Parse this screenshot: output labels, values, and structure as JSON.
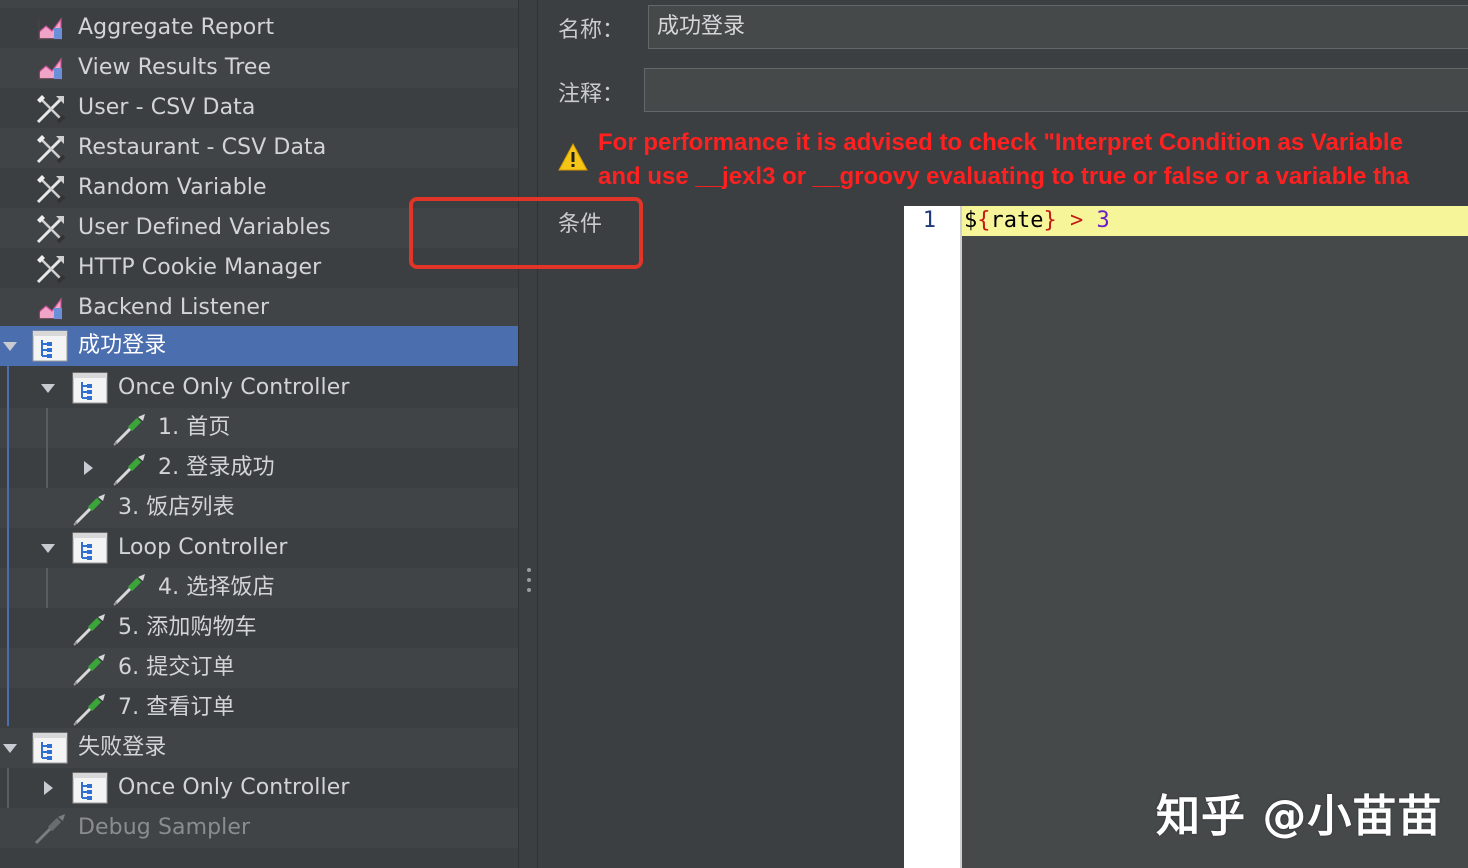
{
  "tree": {
    "items": [
      {
        "label": "Aggregate Report",
        "icon": "listener-chart-icon"
      },
      {
        "label": "View Results Tree",
        "icon": "listener-chart-icon"
      },
      {
        "label": "User - CSV Data",
        "icon": "config-tools-icon"
      },
      {
        "label": "Restaurant - CSV Data",
        "icon": "config-tools-icon"
      },
      {
        "label": "Random Variable",
        "icon": "config-tools-icon"
      },
      {
        "label": "User Defined Variables",
        "icon": "config-tools-icon"
      },
      {
        "label": "HTTP Cookie Manager",
        "icon": "config-tools-icon"
      },
      {
        "label": "Backend Listener",
        "icon": "listener-chart-icon"
      },
      {
        "label": "成功登录",
        "icon": "controller-icon",
        "expanded": true,
        "selected": true
      },
      {
        "label": "Once Only Controller",
        "icon": "controller-icon",
        "expanded": true
      },
      {
        "label": "1. 首页",
        "icon": "sampler-pipette-icon"
      },
      {
        "label": "2. 登录成功",
        "icon": "sampler-pipette-icon",
        "expanded": false
      },
      {
        "label": "3. 饭店列表",
        "icon": "sampler-pipette-icon"
      },
      {
        "label": "Loop Controller",
        "icon": "controller-icon",
        "expanded": true
      },
      {
        "label": "4. 选择饭店",
        "icon": "sampler-pipette-icon"
      },
      {
        "label": "5. 添加购物车",
        "icon": "sampler-pipette-icon"
      },
      {
        "label": "6. 提交订单",
        "icon": "sampler-pipette-icon"
      },
      {
        "label": "7. 查看订单",
        "icon": "sampler-pipette-icon"
      },
      {
        "label": "失败登录",
        "icon": "controller-icon",
        "expanded": true
      },
      {
        "label": "Once Only Controller",
        "icon": "controller-icon",
        "expanded": false
      },
      {
        "label": "Debug Sampler",
        "icon": "sampler-pipette-icon",
        "disabled": true
      }
    ]
  },
  "form": {
    "name_label": "名称：",
    "name_value": "成功登录",
    "comment_label": "注释：",
    "comment_value": "",
    "warning_line1": "For performance it is advised to check \"Interpret Condition as Variable",
    "warning_line2": "and use __jexl3 or __groovy evaluating to true or false or a variable tha",
    "condition_label": "条件",
    "code": {
      "line_number": "1",
      "dollar": "$",
      "brace_open": "{",
      "var_name": "rate",
      "brace_close": "}",
      "operator": " > ",
      "number": "3"
    }
  },
  "colors": {
    "selection": "#4b6eaf",
    "warning": "#ff2020",
    "highlight_box": "#e03528",
    "current_line": "#f7f59a"
  },
  "watermark": "知乎 @小苗苗"
}
